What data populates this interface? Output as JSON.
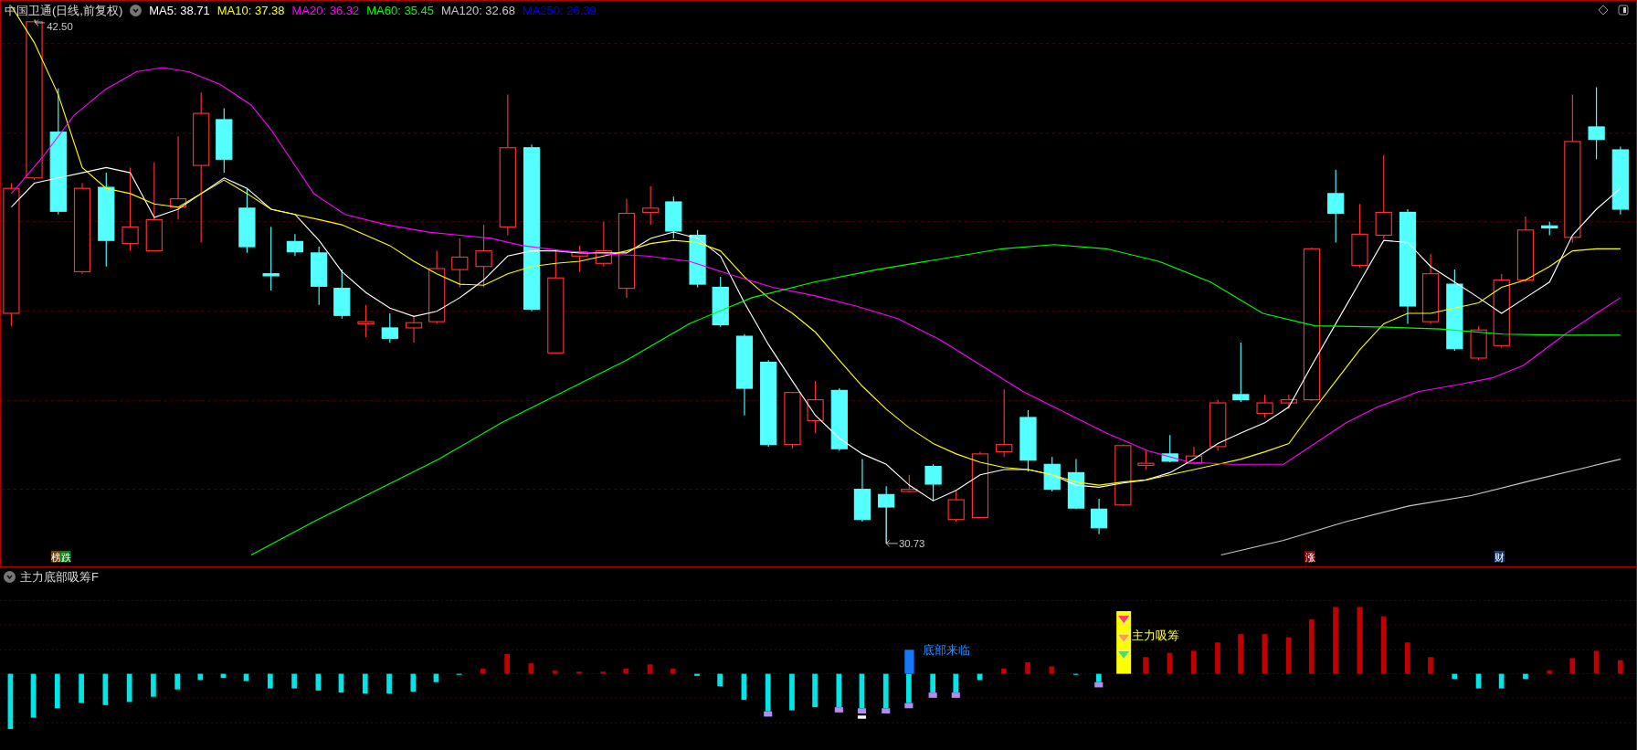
{
  "header": {
    "title": "中国卫通(日线,前复权)",
    "moving_averages": [
      {
        "label": "MA5: 38.71",
        "color": "#ffffff"
      },
      {
        "label": "MA10: 37.38",
        "color": "#ffff00"
      },
      {
        "label": "MA20: 36.32",
        "color": "#ff00ff"
      },
      {
        "label": "MA60: 35.45",
        "color": "#00ff00"
      },
      {
        "label": "MA120: 32.68",
        "color": "#c8c8c8"
      },
      {
        "label": "MA250: 26.39",
        "color": "#0000ff"
      }
    ]
  },
  "main_chart": {
    "high_label": "42.50",
    "low_label": "30.73",
    "event_tags": [
      {
        "text": "榜",
        "color": "#7b3f00"
      },
      {
        "text": "跌",
        "color": "#008000"
      },
      {
        "text": "涨",
        "color": "#8b0000"
      },
      {
        "text": "财",
        "color": "#1a3a6e"
      }
    ]
  },
  "indicator": {
    "title": "主力底部吸筹F",
    "bottom_signal": "底部来临",
    "accumulation_signal": "主力吸筹"
  }
}
